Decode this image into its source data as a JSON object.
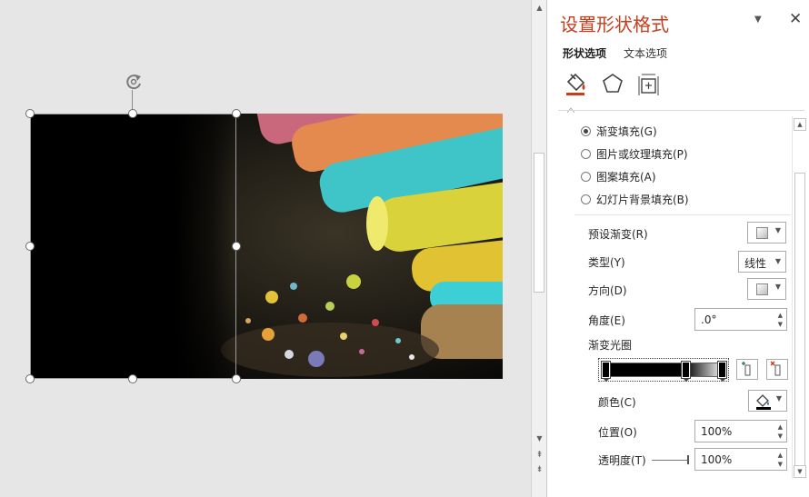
{
  "canvas": {
    "image": "chalk-photo",
    "shape_fill": "gradient black-to-transparent"
  },
  "pane": {
    "title": "设置形状格式",
    "tabs": [
      {
        "label": "形状选项",
        "active": true
      },
      {
        "label": "文本选项",
        "active": false
      }
    ],
    "categories": [
      "fill-line-icon",
      "effects-pentagon-icon",
      "size-properties-icon"
    ],
    "fill_options": [
      {
        "label": "渐变填充(G)",
        "checked": true
      },
      {
        "label": "图片或纹理填充(P)",
        "checked": false
      },
      {
        "label": "图案填充(A)",
        "checked": false
      },
      {
        "label": "幻灯片背景填充(B)",
        "checked": false
      }
    ],
    "preset_label": "预设渐变(R)",
    "type_label": "类型(Y)",
    "type_value": "线性",
    "direction_label": "方向(D)",
    "angle_label": "角度(E)",
    "angle_value": ".0°",
    "stops_label": "渐变光圈",
    "color_label": "颜色(C)",
    "position_label": "位置(O)",
    "position_value": "100%",
    "transparency_label": "透明度(T)",
    "transparency_value": "100%",
    "accent_color": "#c43e1c"
  }
}
